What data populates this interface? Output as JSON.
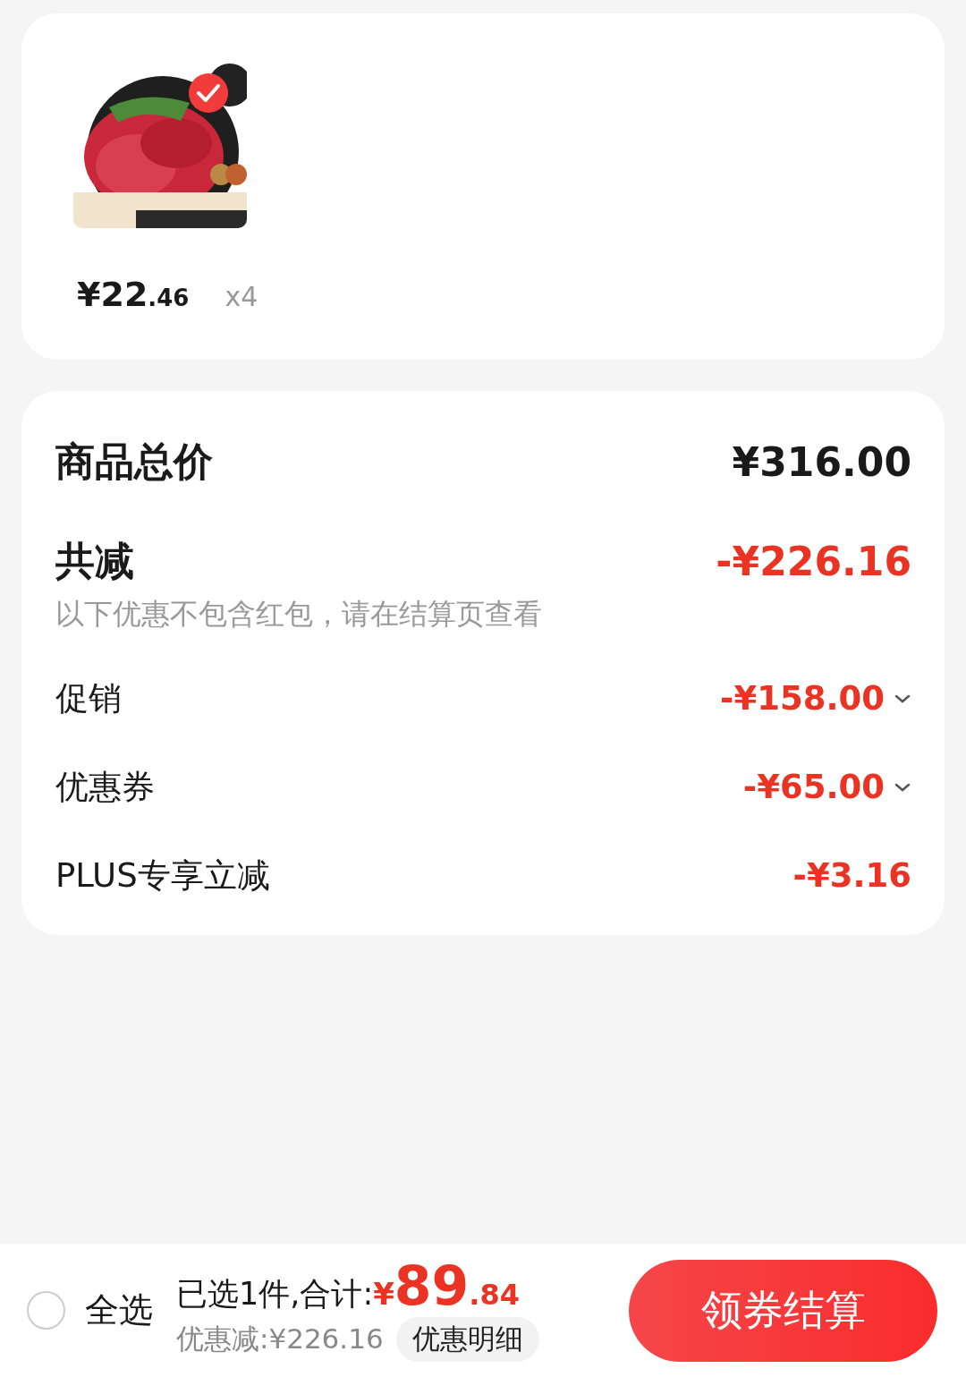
{
  "product": {
    "selected": true,
    "price_main": "¥22",
    "price_decimal": ".46",
    "quantity": "x4"
  },
  "summary": {
    "total": {
      "label": "商品总价",
      "value": "¥316.00"
    },
    "discount": {
      "label": "共减",
      "value": "-¥226.16",
      "note": "以下优惠不包含红包，请在结算页查看"
    },
    "items": [
      {
        "label": "促销",
        "value": "-¥158.00",
        "expandable": true
      },
      {
        "label": "优惠券",
        "value": "-¥65.00",
        "expandable": true
      },
      {
        "label": "PLUS专享立减",
        "value": "-¥3.16",
        "expandable": false
      }
    ]
  },
  "footer": {
    "select_all": {
      "label": "全选",
      "checked": false
    },
    "selected_text": "已选1件,合计:",
    "currency": "¥",
    "amount_main": "89",
    "amount_decimal": ".84",
    "discount_text": "优惠减:¥226.16",
    "detail_button": "优惠明细",
    "checkout_button": "领券结算"
  }
}
